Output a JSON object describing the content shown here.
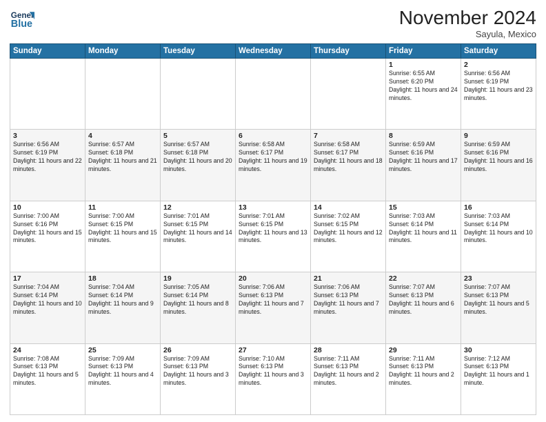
{
  "header": {
    "logo_general": "General",
    "logo_blue": "Blue",
    "title": "November 2024",
    "subtitle": "Sayula, Mexico"
  },
  "days_of_week": [
    "Sunday",
    "Monday",
    "Tuesday",
    "Wednesday",
    "Thursday",
    "Friday",
    "Saturday"
  ],
  "weeks": [
    [
      {
        "day": "",
        "text": ""
      },
      {
        "day": "",
        "text": ""
      },
      {
        "day": "",
        "text": ""
      },
      {
        "day": "",
        "text": ""
      },
      {
        "day": "",
        "text": ""
      },
      {
        "day": "1",
        "text": "Sunrise: 6:55 AM\nSunset: 6:20 PM\nDaylight: 11 hours and 24 minutes."
      },
      {
        "day": "2",
        "text": "Sunrise: 6:56 AM\nSunset: 6:19 PM\nDaylight: 11 hours and 23 minutes."
      }
    ],
    [
      {
        "day": "3",
        "text": "Sunrise: 6:56 AM\nSunset: 6:19 PM\nDaylight: 11 hours and 22 minutes."
      },
      {
        "day": "4",
        "text": "Sunrise: 6:57 AM\nSunset: 6:18 PM\nDaylight: 11 hours and 21 minutes."
      },
      {
        "day": "5",
        "text": "Sunrise: 6:57 AM\nSunset: 6:18 PM\nDaylight: 11 hours and 20 minutes."
      },
      {
        "day": "6",
        "text": "Sunrise: 6:58 AM\nSunset: 6:17 PM\nDaylight: 11 hours and 19 minutes."
      },
      {
        "day": "7",
        "text": "Sunrise: 6:58 AM\nSunset: 6:17 PM\nDaylight: 11 hours and 18 minutes."
      },
      {
        "day": "8",
        "text": "Sunrise: 6:59 AM\nSunset: 6:16 PM\nDaylight: 11 hours and 17 minutes."
      },
      {
        "day": "9",
        "text": "Sunrise: 6:59 AM\nSunset: 6:16 PM\nDaylight: 11 hours and 16 minutes."
      }
    ],
    [
      {
        "day": "10",
        "text": "Sunrise: 7:00 AM\nSunset: 6:16 PM\nDaylight: 11 hours and 15 minutes."
      },
      {
        "day": "11",
        "text": "Sunrise: 7:00 AM\nSunset: 6:15 PM\nDaylight: 11 hours and 15 minutes."
      },
      {
        "day": "12",
        "text": "Sunrise: 7:01 AM\nSunset: 6:15 PM\nDaylight: 11 hours and 14 minutes."
      },
      {
        "day": "13",
        "text": "Sunrise: 7:01 AM\nSunset: 6:15 PM\nDaylight: 11 hours and 13 minutes."
      },
      {
        "day": "14",
        "text": "Sunrise: 7:02 AM\nSunset: 6:15 PM\nDaylight: 11 hours and 12 minutes."
      },
      {
        "day": "15",
        "text": "Sunrise: 7:03 AM\nSunset: 6:14 PM\nDaylight: 11 hours and 11 minutes."
      },
      {
        "day": "16",
        "text": "Sunrise: 7:03 AM\nSunset: 6:14 PM\nDaylight: 11 hours and 10 minutes."
      }
    ],
    [
      {
        "day": "17",
        "text": "Sunrise: 7:04 AM\nSunset: 6:14 PM\nDaylight: 11 hours and 10 minutes."
      },
      {
        "day": "18",
        "text": "Sunrise: 7:04 AM\nSunset: 6:14 PM\nDaylight: 11 hours and 9 minutes."
      },
      {
        "day": "19",
        "text": "Sunrise: 7:05 AM\nSunset: 6:14 PM\nDaylight: 11 hours and 8 minutes."
      },
      {
        "day": "20",
        "text": "Sunrise: 7:06 AM\nSunset: 6:13 PM\nDaylight: 11 hours and 7 minutes."
      },
      {
        "day": "21",
        "text": "Sunrise: 7:06 AM\nSunset: 6:13 PM\nDaylight: 11 hours and 7 minutes."
      },
      {
        "day": "22",
        "text": "Sunrise: 7:07 AM\nSunset: 6:13 PM\nDaylight: 11 hours and 6 minutes."
      },
      {
        "day": "23",
        "text": "Sunrise: 7:07 AM\nSunset: 6:13 PM\nDaylight: 11 hours and 5 minutes."
      }
    ],
    [
      {
        "day": "24",
        "text": "Sunrise: 7:08 AM\nSunset: 6:13 PM\nDaylight: 11 hours and 5 minutes."
      },
      {
        "day": "25",
        "text": "Sunrise: 7:09 AM\nSunset: 6:13 PM\nDaylight: 11 hours and 4 minutes."
      },
      {
        "day": "26",
        "text": "Sunrise: 7:09 AM\nSunset: 6:13 PM\nDaylight: 11 hours and 3 minutes."
      },
      {
        "day": "27",
        "text": "Sunrise: 7:10 AM\nSunset: 6:13 PM\nDaylight: 11 hours and 3 minutes."
      },
      {
        "day": "28",
        "text": "Sunrise: 7:11 AM\nSunset: 6:13 PM\nDaylight: 11 hours and 2 minutes."
      },
      {
        "day": "29",
        "text": "Sunrise: 7:11 AM\nSunset: 6:13 PM\nDaylight: 11 hours and 2 minutes."
      },
      {
        "day": "30",
        "text": "Sunrise: 7:12 AM\nSunset: 6:13 PM\nDaylight: 11 hours and 1 minute."
      }
    ]
  ]
}
